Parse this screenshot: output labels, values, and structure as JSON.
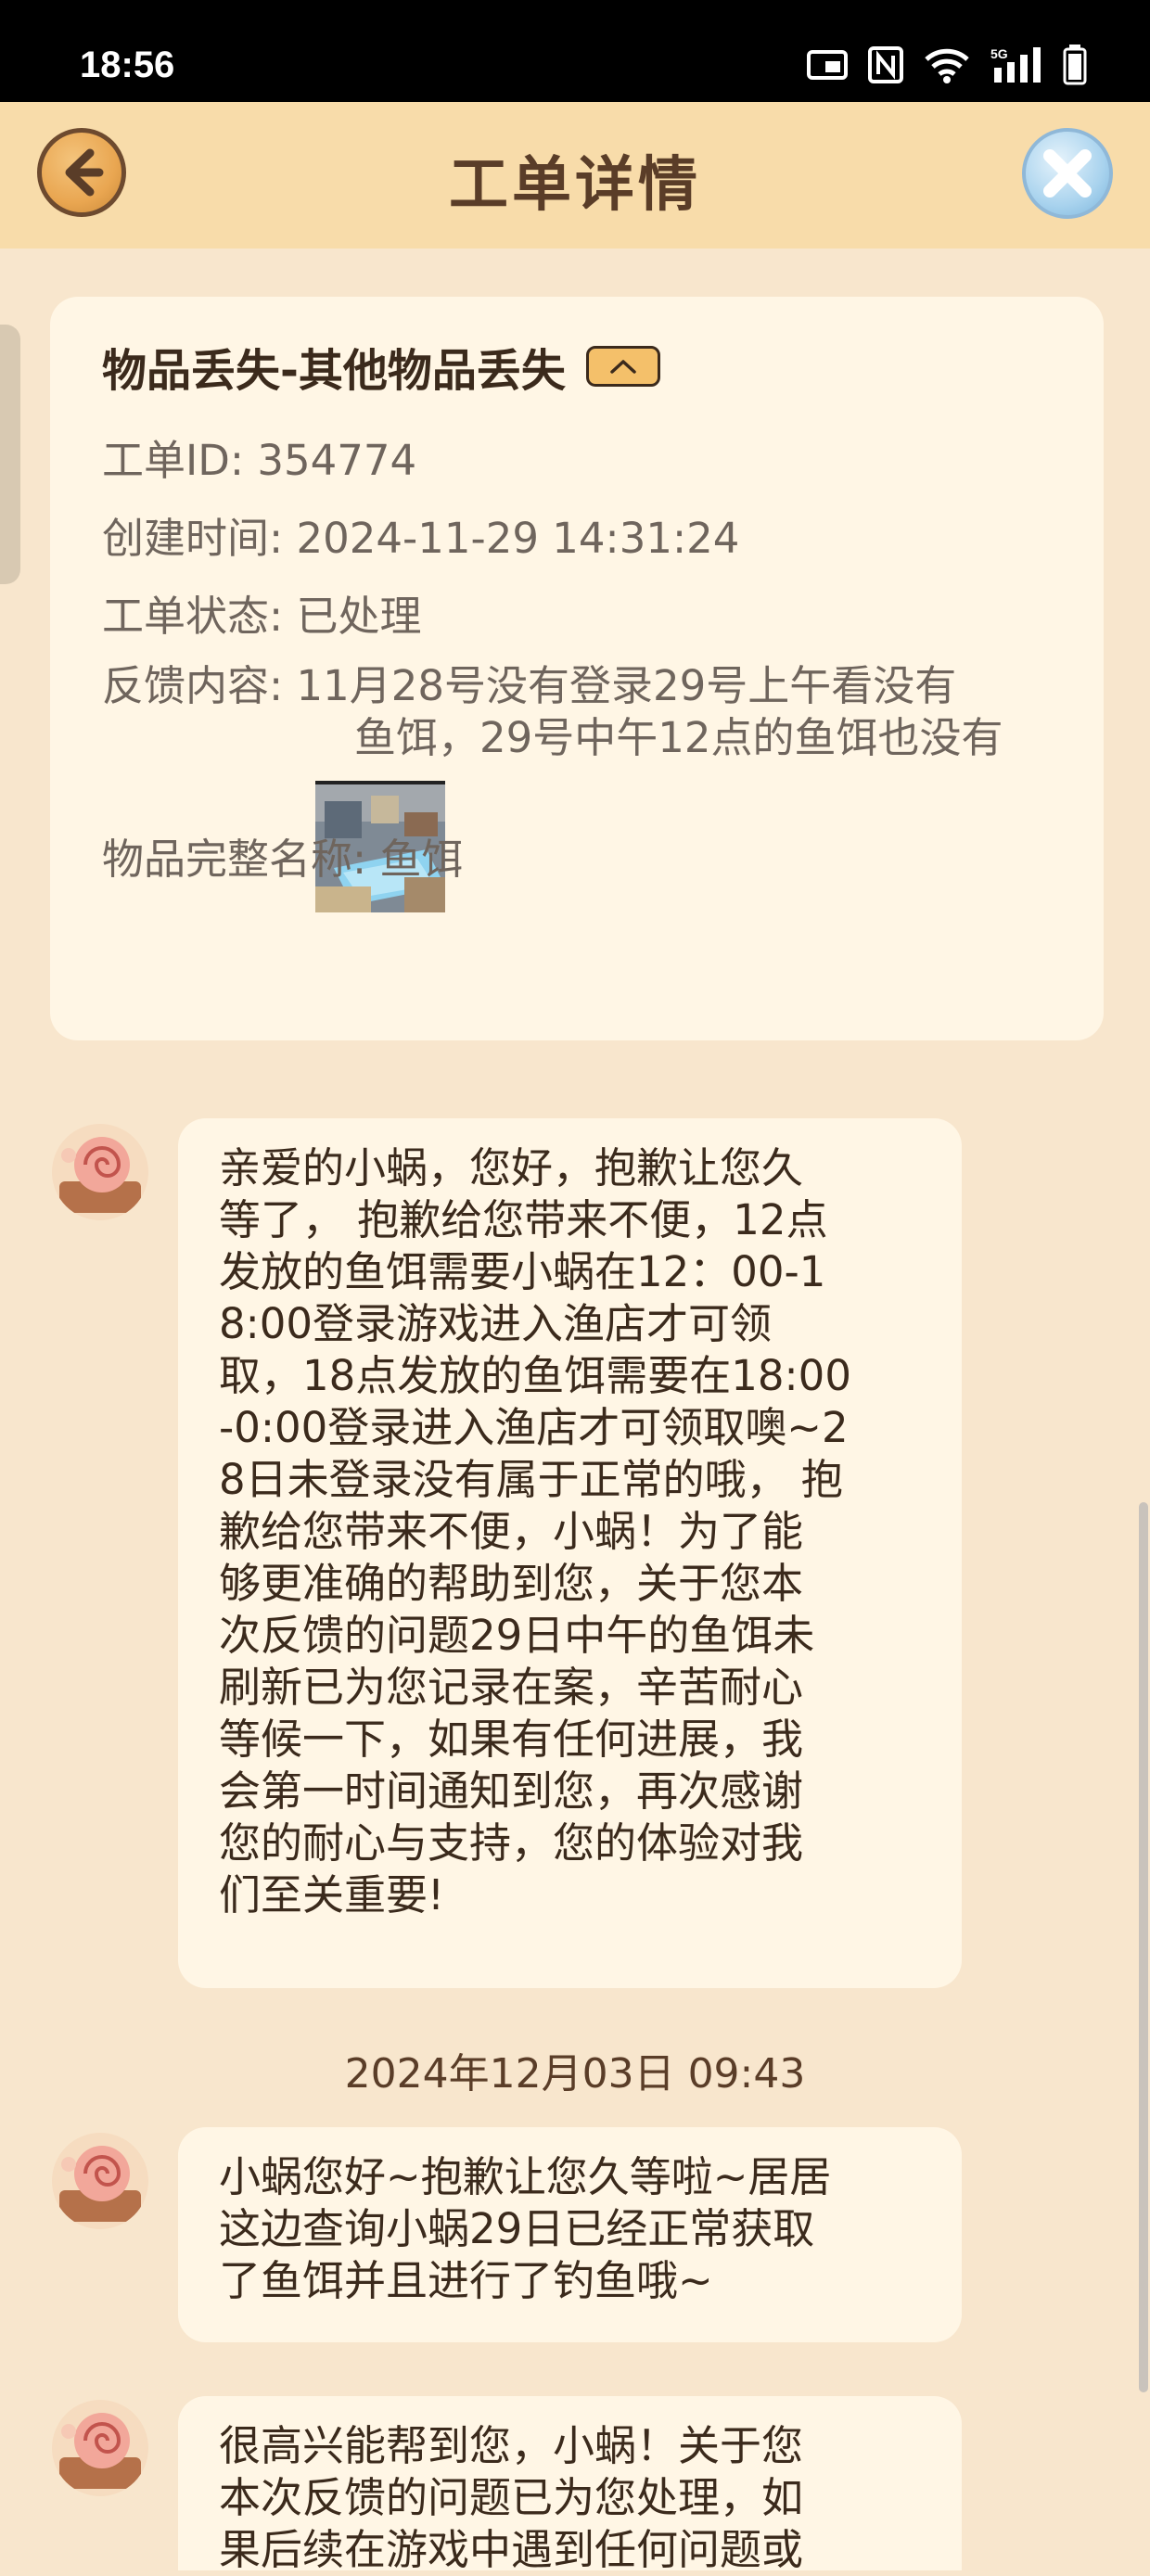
{
  "status_bar": {
    "time": "18:56",
    "icons": [
      "cast-icon",
      "nfc-icon",
      "wifi-icon",
      "signal-5g-icon",
      "battery-icon"
    ]
  },
  "header": {
    "title": "工单详情",
    "back_icon": "back-arrow-icon",
    "close_icon": "close-icon"
  },
  "ticket": {
    "title": "物品丢失-其他物品丢失",
    "rows": [
      {
        "label": "工单ID: ",
        "value": "354774"
      },
      {
        "label": "创建时间: ",
        "value": "2024-11-29 14:31:24"
      },
      {
        "label": "工单状态: ",
        "value": "已处理"
      }
    ],
    "feedback_label": "反馈内容: ",
    "feedback_lines": [
      "11月28号没有登录29号上午看没有",
      "鱼饵，29号中午12点的鱼饵也没有"
    ],
    "item_name_label": "物品完整名称: ",
    "item_name_value": "鱼饵"
  },
  "messages": [
    {
      "lines": [
        "亲爱的小蜗，您好，抱歉让您久",
        "等了， 抱歉给您带来不便，12点",
        "发放的鱼饵需要小蜗在12：00-1",
        "8:00登录游戏进入渔店才可领",
        "取，18点发放的鱼饵需要在18:00",
        "-0:00登录进入渔店才可领取噢~2",
        "8日未登录没有属于正常的哦， 抱",
        "歉给您带来不便，小蜗！为了能",
        "够更准确的帮助到您，关于您本",
        "次反馈的问题29日中午的鱼饵未",
        "刷新已为您记录在案，辛苦耐心",
        "等候一下，如果有任何进展，我",
        "会第一时间通知到您，再次感谢",
        "您的耐心与支持，您的体验对我",
        "们至关重要!"
      ]
    },
    {
      "lines": [
        "小蜗您好~抱歉让您久等啦~居居",
        "这边查询小蜗29日已经正常获取",
        "了鱼饵并且进行了钓鱼哦~"
      ]
    },
    {
      "lines": [
        "很高兴能帮到您，小蜗！关于您",
        "本次反馈的问题已为您处理，如",
        "果后续在游戏中遇到任何问题或"
      ]
    }
  ],
  "timestamp": "2024年12月03日 09:43"
}
